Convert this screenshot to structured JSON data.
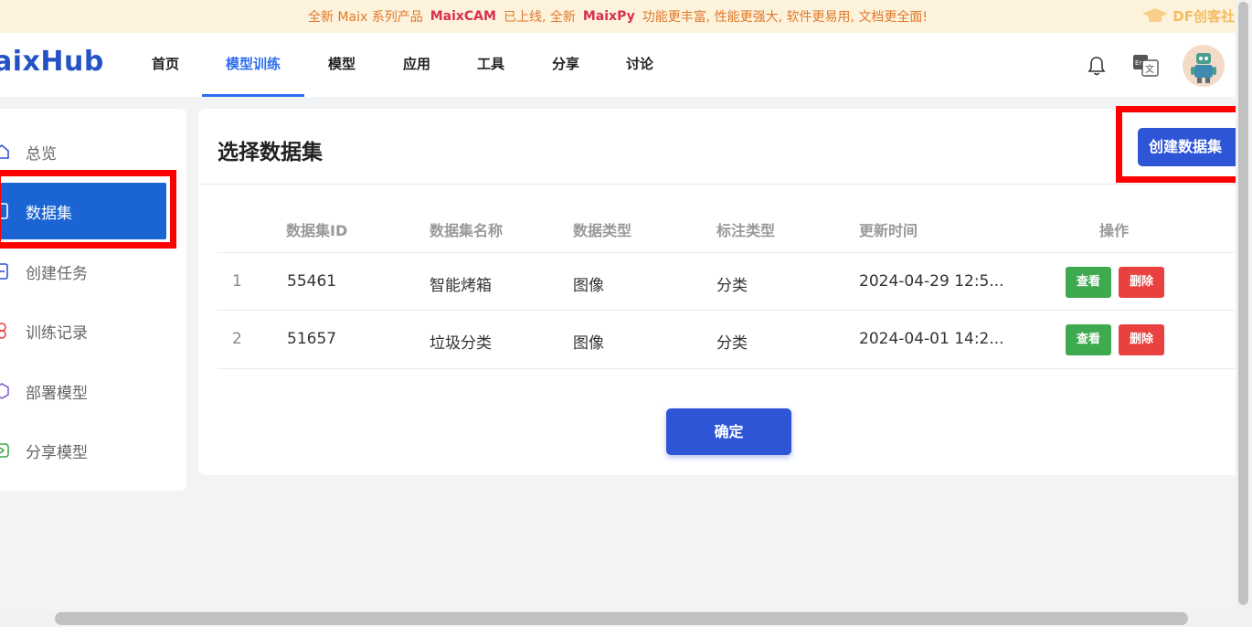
{
  "banner": {
    "prefix": "全新 Maix 系列产品",
    "product1": "MaixCAM",
    "middle": "已上线, 全新",
    "product2": "MaixPy",
    "suffix": "功能更丰富, 性能更强大, 软件更易用, 文档更全面!",
    "watermark": "DF创客社区"
  },
  "nav": {
    "logo": "aixHub",
    "items": [
      {
        "label": "首页"
      },
      {
        "label": "模型训练"
      },
      {
        "label": "模型"
      },
      {
        "label": "应用"
      },
      {
        "label": "工具"
      },
      {
        "label": "分享"
      },
      {
        "label": "讨论"
      }
    ],
    "active_index": 1,
    "icons": [
      "bell-icon",
      "language-icon",
      "avatar"
    ]
  },
  "sidebar": {
    "items": [
      {
        "label": "总览",
        "icon": "home-icon"
      },
      {
        "label": "数据集",
        "icon": "dataset-icon"
      },
      {
        "label": "创建任务",
        "icon": "create-task-icon"
      },
      {
        "label": "训练记录",
        "icon": "training-record-icon"
      },
      {
        "label": "部署模型",
        "icon": "deploy-model-icon"
      },
      {
        "label": "分享模型",
        "icon": "share-model-icon"
      }
    ],
    "active_index": 1
  },
  "main": {
    "title": "选择数据集",
    "create_button": "创建数据集",
    "table": {
      "headers": [
        "数据集ID",
        "数据集名称",
        "数据类型",
        "标注类型",
        "更新时间",
        "操作"
      ],
      "rows": [
        {
          "index": "1",
          "id": "55461",
          "name": "智能烤箱",
          "data_type": "图像",
          "label_type": "分类",
          "updated": "2024-04-29 12:5...",
          "view": "查看",
          "delete": "删除"
        },
        {
          "index": "2",
          "id": "51657",
          "name": "垃圾分类",
          "data_type": "图像",
          "label_type": "分类",
          "updated": "2024-04-01 14:2...",
          "view": "查看",
          "delete": "删除"
        }
      ]
    },
    "confirm_button": "确定"
  },
  "colors": {
    "primary": "#2e55d6",
    "sidebar_active": "#1a64d4",
    "view_green": "#3fa94f",
    "delete_red": "#e8413f",
    "highlight_red": "#ff0000",
    "banner_bg": "#fdf3dc"
  }
}
